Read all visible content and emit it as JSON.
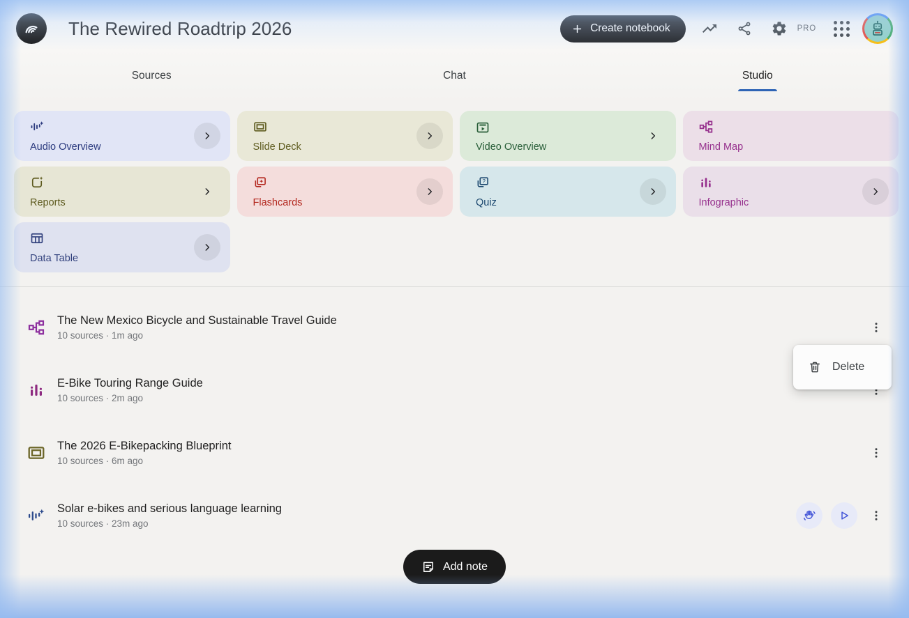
{
  "header": {
    "app_logo": "notebooklm-logo",
    "title": "The Rewired Roadtrip 2026",
    "create_button": {
      "label": "Create notebook",
      "icon": "plus-icon"
    },
    "pro_badge": "PRO",
    "actions": [
      {
        "name": "analytics",
        "icon": "trending-up-icon"
      },
      {
        "name": "share",
        "icon": "share-icon"
      },
      {
        "name": "settings",
        "icon": "gear-icon"
      },
      {
        "name": "apps",
        "icon": "apps-grid-icon"
      },
      {
        "name": "account",
        "icon": "avatar-robot"
      }
    ]
  },
  "tabs": [
    {
      "label": "Sources",
      "active": false
    },
    {
      "label": "Chat",
      "active": false
    },
    {
      "label": "Studio",
      "active": true
    }
  ],
  "studio": {
    "cards": [
      {
        "label": "Audio Overview",
        "icon": "audio-waveform-sparkle-icon",
        "bg": "#e1e5f6",
        "fg": "#2b3a7e",
        "chevron": "circle"
      },
      {
        "label": "Slide Deck",
        "icon": "slide-deck-icon",
        "bg": "#e9e8d7",
        "fg": "#5f5c20",
        "chevron": "circle"
      },
      {
        "label": "Video Overview",
        "icon": "video-overview-icon",
        "bg": "#dcead9",
        "fg": "#265c36",
        "chevron": "plain"
      },
      {
        "label": "Mind Map",
        "icon": "mind-map-icon",
        "bg": "#ecdfe8",
        "fg": "#96308d",
        "chevron": "none"
      },
      {
        "label": "Reports",
        "icon": "reports-sparkle-icon",
        "bg": "#e7e6d5",
        "fg": "#5e5b1f",
        "chevron": "plain"
      },
      {
        "label": "Flashcards",
        "icon": "flashcards-icon",
        "bg": "#f4dddc",
        "fg": "#b3271e",
        "chevron": "circle"
      },
      {
        "label": "Quiz",
        "icon": "quiz-icon",
        "bg": "#d6e7eb",
        "fg": "#1c486f",
        "chevron": "circle"
      },
      {
        "label": "Infographic",
        "icon": "infographic-bars-icon",
        "bg": "#eadfe9",
        "fg": "#96308d",
        "chevron": "circle"
      },
      {
        "label": "Data Table",
        "icon": "data-table-icon",
        "bg": "#dfe2f0",
        "fg": "#33427e",
        "chevron": "circle"
      }
    ]
  },
  "artifacts": [
    {
      "title": "The New Mexico Bicycle and Sustainable Travel Guide",
      "meta": "10 sources · 1m ago",
      "icon": "mind-map-icon",
      "icon_color": "#8d2f9e"
    },
    {
      "title": "E-Bike Touring Range Guide",
      "meta": "10 sources · 2m ago",
      "icon": "infographic-bars-icon",
      "icon_color": "#8d2a80"
    },
    {
      "title": "The 2026 E-Bikepacking Blueprint",
      "meta": "10 sources · 6m ago",
      "icon": "slide-deck-icon",
      "icon_color": "#6b6527"
    },
    {
      "title": "Solar e-bikes and serious language learning",
      "meta": "10 sources · 23m ago",
      "icon": "audio-waveform-sparkle-icon",
      "icon_color": "#2c4a8c",
      "controls": [
        {
          "name": "interactive-mode",
          "icon": "waving-hand-icon"
        },
        {
          "name": "play",
          "icon": "play-icon"
        }
      ]
    }
  ],
  "context_menu": {
    "visible": true,
    "items": [
      {
        "label": "Delete",
        "icon": "trash-icon"
      }
    ]
  },
  "footer": {
    "add_note": {
      "label": "Add note",
      "icon": "note-icon"
    }
  },
  "colors": {
    "accent_underline": "#2e64b5",
    "pill_black": "#202124",
    "page_bg": "#f3f2f0",
    "edge_glow": "#9dc0ee",
    "menu_bg": "#fcfcfc",
    "audio_control_blue": "#4456d8"
  }
}
